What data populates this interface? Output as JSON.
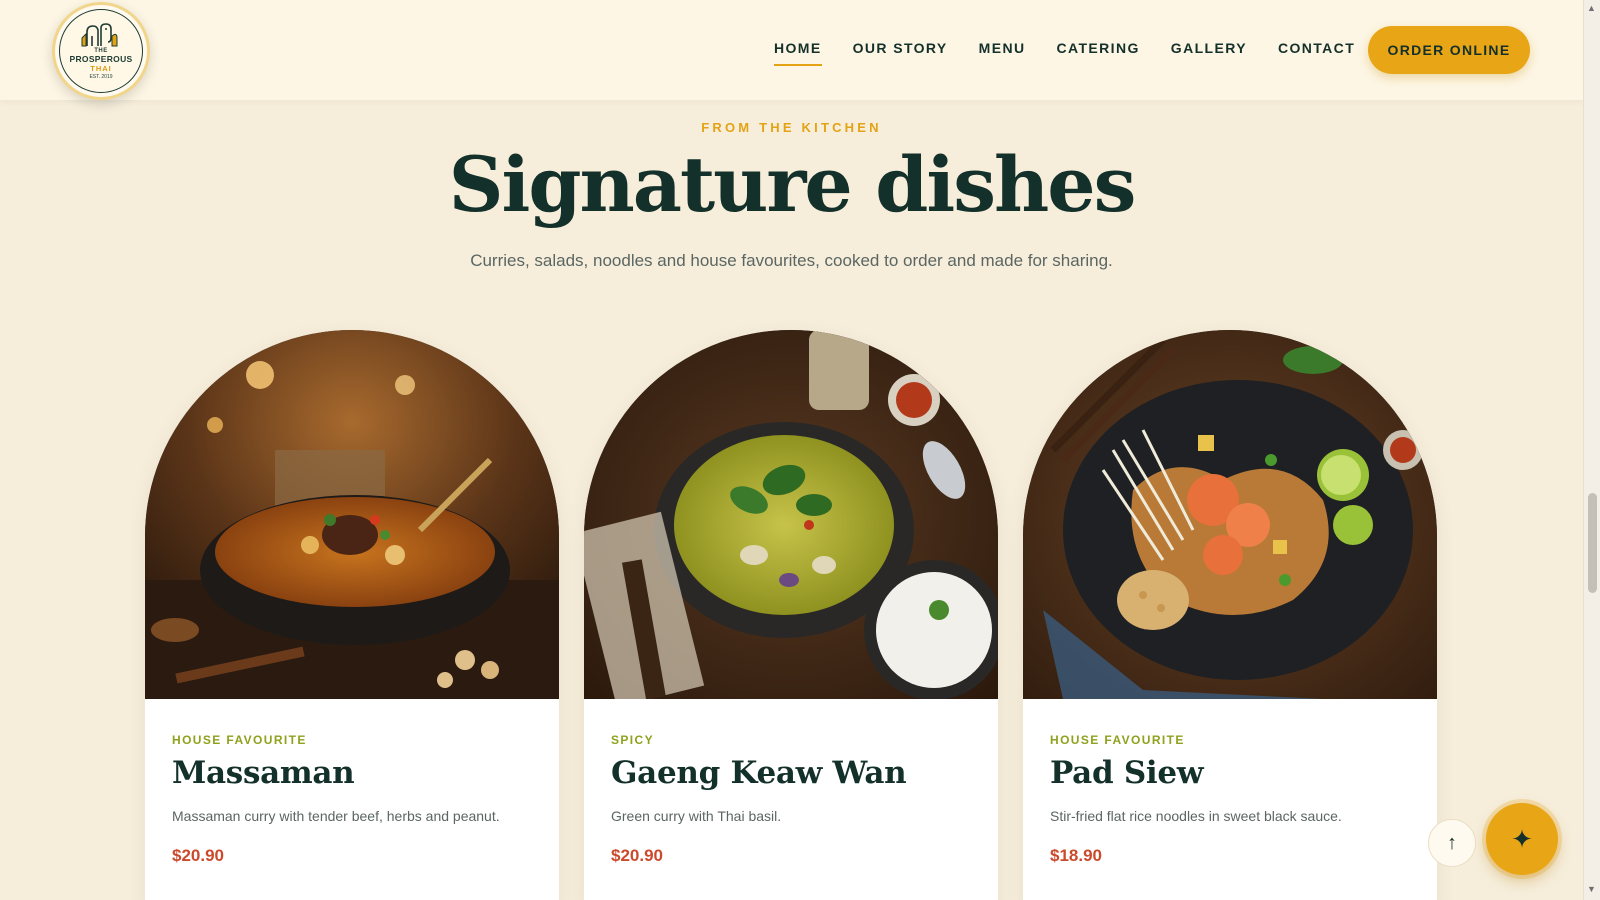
{
  "header": {
    "logo": {
      "line1": "THE",
      "line2": "PROSPEROUS",
      "line3": "THAI",
      "line4": "EST. 2019"
    },
    "nav": [
      {
        "label": "HOME",
        "active": true
      },
      {
        "label": "OUR STORY",
        "active": false
      },
      {
        "label": "MENU",
        "active": false
      },
      {
        "label": "CATERING",
        "active": false
      },
      {
        "label": "GALLERY",
        "active": false
      },
      {
        "label": "CONTACT",
        "active": false
      }
    ],
    "order_button": "ORDER ONLINE"
  },
  "section": {
    "eyebrow": "FROM THE KITCHEN",
    "title": "Signature dishes",
    "subtitle": "Curries, salads, noodles and house favourites, cooked to order and made for sharing."
  },
  "cards": [
    {
      "tag": "HOUSE FAVOURITE",
      "name": "Massaman",
      "description": "Massaman curry with tender beef, herbs and peanut.",
      "price": "$20.90",
      "image": "massaman-curry-photo"
    },
    {
      "tag": "SPICY",
      "name": "Gaeng Keaw Wan",
      "description": "Green curry with Thai basil.",
      "price": "$20.90",
      "image": "green-curry-photo"
    },
    {
      "tag": "HOUSE FAVOURITE",
      "name": "Pad Siew",
      "description": "Stir-fried flat rice noodles in sweet black sauce.",
      "price": "$18.90",
      "image": "pad-siew-photo"
    }
  ],
  "floating": {
    "back_to_top_icon": "arrow-up-icon",
    "assistant_icon": "sparkle-icon"
  },
  "colors": {
    "accent": "#e8a516",
    "brand_dark": "#14302a",
    "tag_green": "#8ea21c",
    "price_red": "#cc4a2c",
    "page_bg": "#f6eedb"
  }
}
